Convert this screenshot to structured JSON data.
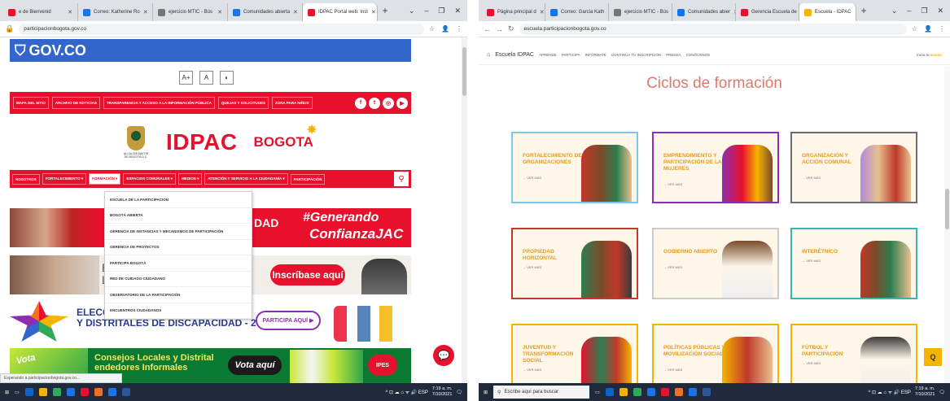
{
  "colors": {
    "gov_blue": "#3366cc",
    "idpac_red": "#e8112d",
    "card_accent": "#e69b1a",
    "heading_coral": "#e0776d",
    "taskbar": "#1f2a3c"
  },
  "left": {
    "browser": {
      "tabs": [
        {
          "label": "e de Bienvenid",
          "color": "#e8112d",
          "active": false
        },
        {
          "label": "Correo: Katherine Ro",
          "color": "#1a73e8",
          "active": false
        },
        {
          "label": "ejercicio MTIC - Bús",
          "color": "#777777",
          "active": false
        },
        {
          "label": "Comunidades abierta",
          "color": "#1a73e8",
          "active": false
        },
        {
          "label": "IDPAC Portal web: Inst",
          "color": "#e8112d",
          "active": true
        }
      ],
      "new_tab": "+",
      "window_controls": [
        "⌄",
        "–",
        "❐",
        "✕"
      ],
      "url": "participacionbogota.gov.co",
      "addr_icons": [
        "☆",
        "👤",
        "⋮"
      ]
    },
    "gov_label": "GOV.CO",
    "accessibility": [
      "A+",
      "A",
      "◐"
    ],
    "top_nav": [
      "MAPA DEL SITIO",
      "ARCHIVO DE NOTICIAS",
      "TRANSPARENCIA Y ACCESO A LA INFORMACIÓN PÚBLICA",
      "QUEJAS Y SOLICITUDES",
      "ZONA PARA NIÑOS"
    ],
    "social": [
      "f",
      "t",
      "◎",
      "▶"
    ],
    "logo": {
      "caption": "ALCALDÍA MAYOR DE BOGOTÁ D.C.",
      "brand": "IDPAC",
      "city": "BOGOTA"
    },
    "main_nav": [
      {
        "label": "NOSOTROS",
        "open": false
      },
      {
        "label": "FORTALECIMIENTO ▾",
        "open": false
      },
      {
        "label": "FORMACIÓN ▾",
        "open": true
      },
      {
        "label": "ESPACIOS COMUNALES ▾",
        "open": false
      },
      {
        "label": "MEDIOS ▾",
        "open": false
      },
      {
        "label": "ATENCIÓN Y SERVICIO A LA CIUDADANÍA ▾",
        "open": false
      },
      {
        "label": "PARTICIPACIÓN",
        "open": false
      }
    ],
    "dropdown": [
      "ESCUELA DE LA PARTICIPACIÓN",
      "BOGOTÁ ABIERTA",
      "GERENCIA DE INSTANCIAS Y MECANISMOS DE PARTICIPACIÓN",
      "GERENCIA DE PROYECTOS",
      "PARTICIPA BOGOTÁ",
      "RED DE CUIDADO CIUDADANO",
      "OBSERVATORIO DE LA PARTICIPACIÓN",
      "ENCUENTROS CIUDADANOS"
    ],
    "banner1": {
      "text_a": "DAD",
      "hash_line1": "#Generando",
      "hash_line2": "ConfianzaJAC"
    },
    "banner2": {
      "partial": "E\nL",
      "button": "Inscríbase aquí"
    },
    "banner3": {
      "title_line1": "ELECCI",
      "title_line2": "Y DISTRITALES DE DISCAPACIDAD - 2021",
      "button": "PARTICIPA AQUÍ ▶"
    },
    "banner4": {
      "left": "Vota",
      "title_line1": "Consejos Locales y Distrital",
      "title_line2": "endedores Informales",
      "button": "Vota aquí",
      "logo": "IPES"
    },
    "status_text": "Esperando a participacionbogota.gov.co..."
  },
  "right": {
    "browser": {
      "tabs": [
        {
          "label": "Página principal d",
          "color": "#e8112d",
          "active": false
        },
        {
          "label": "Correo: Garcia Kath",
          "color": "#1a73e8",
          "active": false
        },
        {
          "label": "ejercicio MTIC - Bús",
          "color": "#777777",
          "active": false
        },
        {
          "label": "Comunidades abier",
          "color": "#1a73e8",
          "active": false
        },
        {
          "label": "Gerencia Escuela de",
          "color": "#e8112d",
          "active": false
        },
        {
          "label": "Escuela - IDPAC",
          "color": "#f6b400",
          "active": true
        }
      ],
      "new_tab": "+",
      "window_controls": [
        "⌄",
        "–",
        "❐",
        "✕"
      ],
      "url": "escuela.participacionbogota.gov.co",
      "addr_icons": [
        "☆",
        "👤",
        "⋮"
      ]
    },
    "nav": {
      "brand": "Escuela IDPAC",
      "items": [
        "APRENDE",
        "PARTICIPA",
        "INFÓRMATE",
        "CONTINÚA TU INSCRIPCIÓN",
        "PRENSA",
        "CONÓCENOS"
      ],
      "right_text": "Inicia tu ",
      "right_highlight": "sesión"
    },
    "heading": "Ciclos de formación",
    "cards": [
      {
        "title": "FORTALECIMIENTO DE ORGANIZACIONES",
        "sub": "→ VER MÁS",
        "border": "#7ec8e3",
        "figs": "linear-gradient(90deg,#c0392b,#7a4b2a 40%,#2e7d4f 70%,#e8c090)"
      },
      {
        "title": "EMPRENDIMIENTO Y PARTICIPACIÓN DE LAS MUJERES",
        "sub": "→ VER MÁS",
        "border": "#8e2db0",
        "figs": "linear-gradient(90deg,#8e2db0,#e8112d 40%,#f6b400 70%,#7a4b2a)"
      },
      {
        "title": "ORGANIZACIÓN Y ACCIÓN COMUNAL",
        "sub": "→ VER MÁS",
        "border": "#6d6d6d",
        "figs": "linear-gradient(90deg,#b58ad9,#e8c090 35%,#c0392b 70%,#e8c090)"
      },
      {
        "title": "PROPIEDAD HORIZONTAL",
        "sub": "→ VER MÁS",
        "border": "#c0392b",
        "figs": "linear-gradient(90deg,#2e7d4f,#7a4b2a 40%,#c0392b 70%,#3a3a3a)"
      },
      {
        "title": "GOBIERNO ABIERTO",
        "sub": "→ VER MÁS",
        "border": "#cccccc",
        "figs": "linear-gradient(180deg,#7a4b2a,#fdf6e9 45%,#eeeeee)"
      },
      {
        "title": "INTERÉTNICO",
        "sub": "→ VER MÁS",
        "border": "#3bb3b3",
        "figs": "linear-gradient(90deg,#c0392b,#7a4b2a 30%,#2e7d4f 60%,#e8c090)"
      },
      {
        "title": "JUVENTUD Y TRANSFORMACIÓN SOCIAL",
        "sub": "→ VER MÁS",
        "border": "#f6b400",
        "figs": "linear-gradient(90deg,#e8112d,#2e7d4f 40%,#c0392b 70%,#f6b400)"
      },
      {
        "title": "POLÍTICAS PÚBLICAS Y MOVILIZACIÓN SOCIAL",
        "sub": "→ VER MÁS",
        "border": "#f6b400",
        "figs": "linear-gradient(90deg,#f6b400,#c0392b 50%,#e8c090)"
      },
      {
        "title": "FÚTBOL Y PARTICIPACIÓN",
        "sub": "→ VER MÁS",
        "border": "#f6b400",
        "figs": "linear-gradient(180deg,#3a3a3a,#fdf6e9 40%,#eeeeee)"
      }
    ],
    "float_label": "Q"
  },
  "taskbar": {
    "search_placeholder": "Escribe aquí para buscar",
    "apps": [
      "#0a64c8",
      "#f6b400",
      "#2eab5a",
      "#1a73e8",
      "#e8112d",
      "#f36f21",
      "#1a73e8",
      "#2b579a"
    ],
    "tray": "^ ⊡ ☁ ⌂ ᯤ 🔊 ESP",
    "time": "7:19 a. m.",
    "date": "7/10/2021"
  }
}
